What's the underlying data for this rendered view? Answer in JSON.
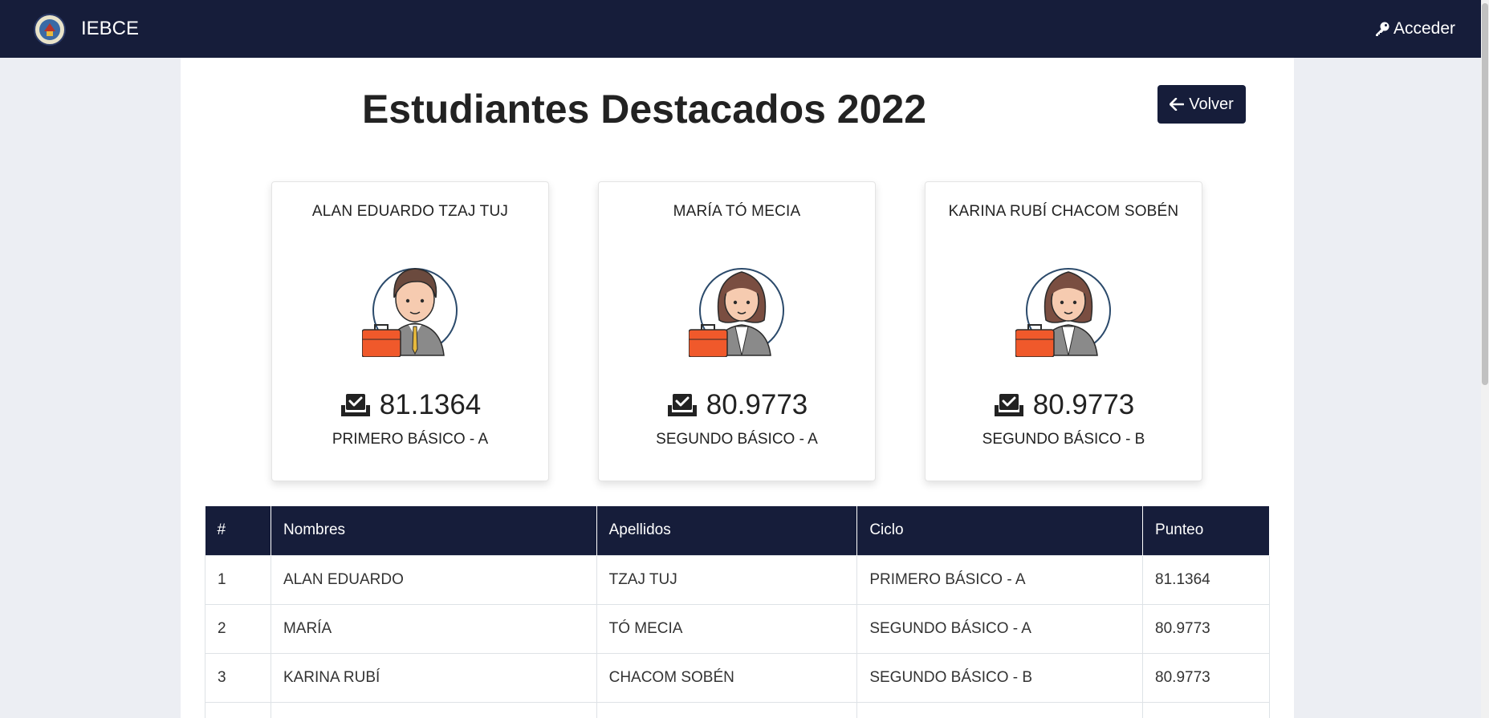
{
  "navbar": {
    "brand": "IEBCE",
    "login": "Acceder"
  },
  "page": {
    "title": "Estudiantes Destacados 2022",
    "back": "Volver"
  },
  "cards": [
    {
      "name": "ALAN EDUARDO TZAJ TUJ",
      "score": "81.1364",
      "ciclo": "PRIMERO BÁSICO - A",
      "avatar": "male-student-avatar"
    },
    {
      "name": "MARÍA TÓ MECIA",
      "score": "80.9773",
      "ciclo": "SEGUNDO BÁSICO - A",
      "avatar": "female-student-avatar"
    },
    {
      "name": "KARINA RUBÍ CHACOM SOBÉN",
      "score": "80.9773",
      "ciclo": "SEGUNDO BÁSICO - B",
      "avatar": "female-student-avatar"
    }
  ],
  "table": {
    "headers": [
      "#",
      "Nombres",
      "Apellidos",
      "Ciclo",
      "Punteo"
    ],
    "rows": [
      [
        "1",
        "ALAN EDUARDO",
        "TZAJ TUJ",
        "PRIMERO BÁSICO - A",
        "81.1364"
      ],
      [
        "2",
        "MARÍA",
        "TÓ MECIA",
        "SEGUNDO BÁSICO - A",
        "80.9773"
      ],
      [
        "3",
        "KARINA RUBÍ",
        "CHACOM SOBÉN",
        "SEGUNDO BÁSICO - B",
        "80.9773"
      ]
    ]
  },
  "colors": {
    "navbar": "#161d3a",
    "briefcase": "#f0592b"
  }
}
